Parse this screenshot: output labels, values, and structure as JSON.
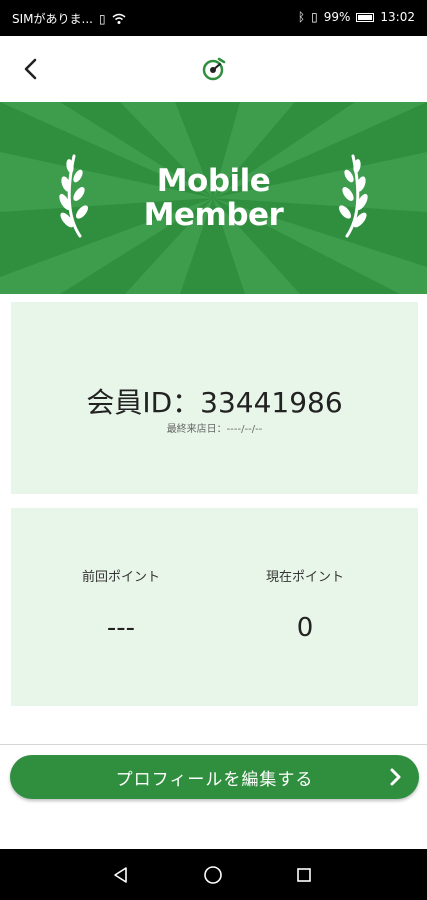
{
  "status_bar": {
    "carrier": "SIMがありま...",
    "battery_percent": "99%",
    "time": "13:02"
  },
  "hero": {
    "title_line1": "Mobile",
    "title_line2": "Member"
  },
  "member": {
    "id_text": "会員ID：33441986",
    "last_visit": "最終来店日：----/--/--"
  },
  "points": {
    "previous_label": "前回ポイント",
    "previous_value": "---",
    "current_label": "現在ポイント",
    "current_value": "0"
  },
  "actions": {
    "edit_profile_label": "プロフィールを編集する"
  },
  "colors": {
    "brand_green": "#2f8f3f",
    "card_bg": "#e8f5e9"
  }
}
